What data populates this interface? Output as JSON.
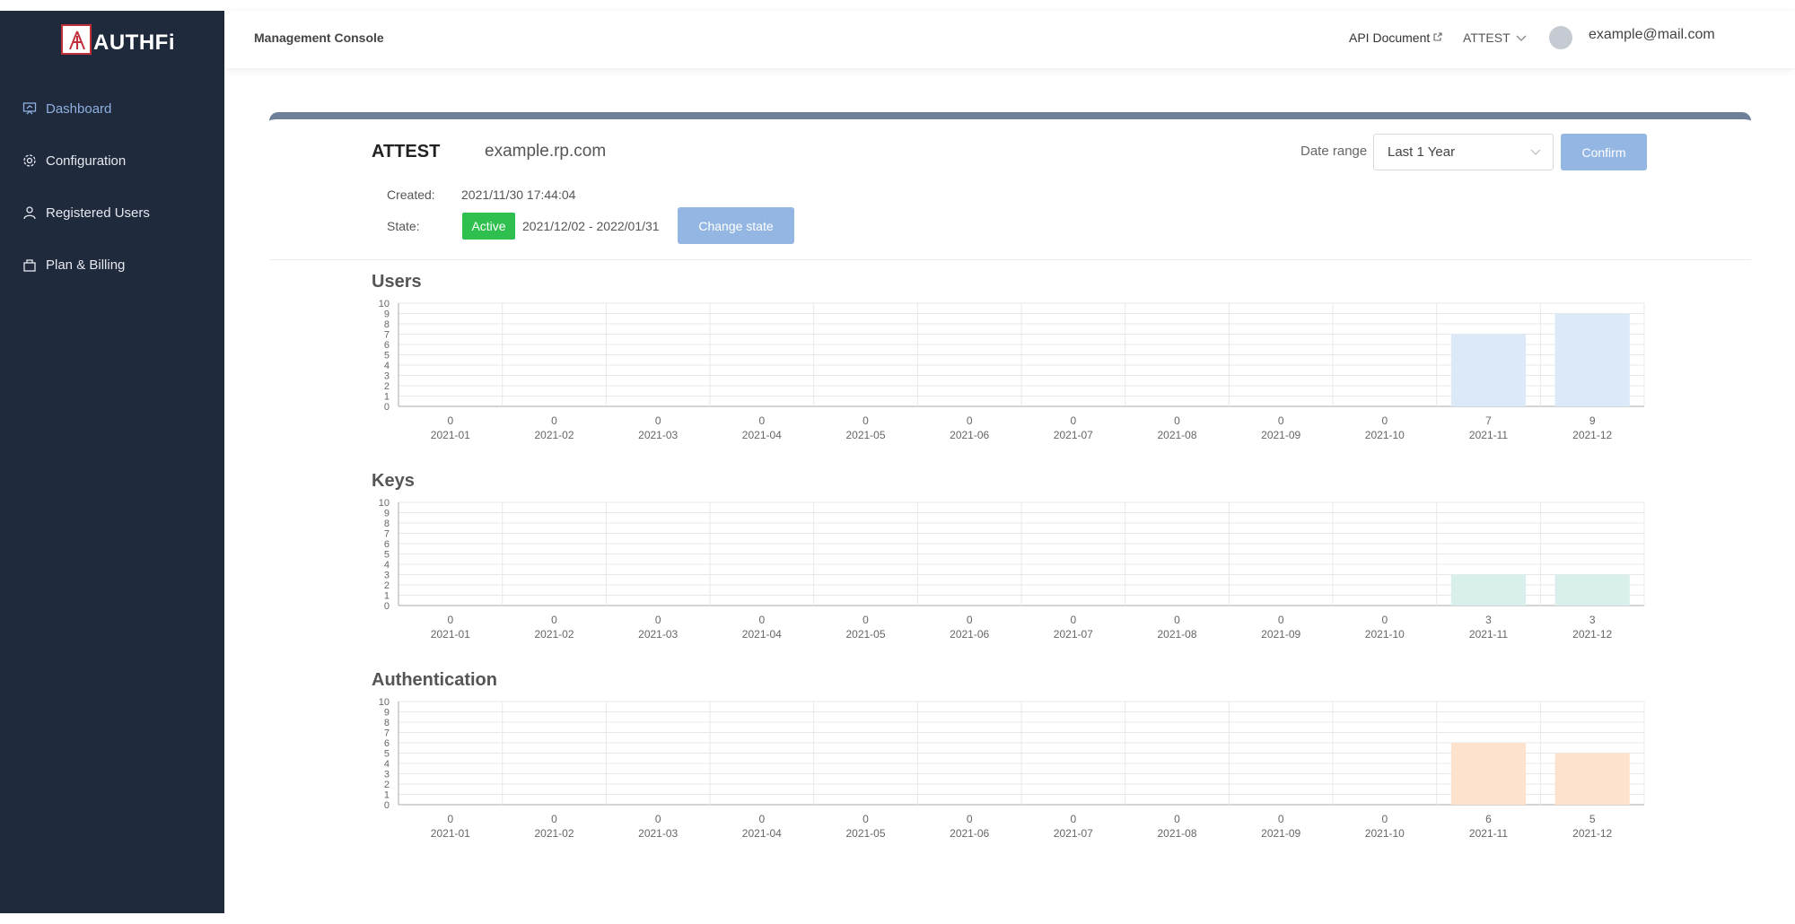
{
  "sidebar": {
    "logo_text": "AUTHFi",
    "items": [
      {
        "label": "Dashboard",
        "icon": "dashboard-icon",
        "active": true
      },
      {
        "label": "Configuration",
        "icon": "gear-icon",
        "active": false
      },
      {
        "label": "Registered Users",
        "icon": "user-icon",
        "active": false
      },
      {
        "label": "Plan & Billing",
        "icon": "bag-icon",
        "active": false
      }
    ]
  },
  "header": {
    "title": "Management Console",
    "api_document": "API Document",
    "tenant": "ATTEST",
    "email": "example@mail.com"
  },
  "app": {
    "name": "ATTEST",
    "domain": "example.rp.com",
    "created_label": "Created:",
    "created_value": "2021/11/30 17:44:04",
    "state_label": "State:",
    "state_badge": "Active",
    "state_period": "2021/12/02 - 2022/01/31",
    "change_state_label": "Change state",
    "date_range_label": "Date range",
    "date_range_value": "Last 1 Year",
    "confirm_label": "Confirm"
  },
  "colors": {
    "sidebar_bg": "#1f2a3d",
    "accent_blue": "#94b6e2",
    "active_green": "#2fbf4f",
    "users_bar": "#dbe9f8",
    "keys_bar": "#d9efeb",
    "auth_bar": "#fde3cd"
  },
  "chart_data": [
    {
      "type": "bar",
      "title": "Users",
      "categories": [
        "2021-01",
        "2021-02",
        "2021-03",
        "2021-04",
        "2021-05",
        "2021-06",
        "2021-07",
        "2021-08",
        "2021-09",
        "2021-10",
        "2021-11",
        "2021-12"
      ],
      "values": [
        0,
        0,
        0,
        0,
        0,
        0,
        0,
        0,
        0,
        0,
        7,
        9
      ],
      "ylim": [
        0,
        10
      ],
      "yticks": [
        0,
        1,
        2,
        3,
        4,
        5,
        6,
        7,
        8,
        9,
        10
      ],
      "grid": true,
      "color": "#dbe9f8"
    },
    {
      "type": "bar",
      "title": "Keys",
      "categories": [
        "2021-01",
        "2021-02",
        "2021-03",
        "2021-04",
        "2021-05",
        "2021-06",
        "2021-07",
        "2021-08",
        "2021-09",
        "2021-10",
        "2021-11",
        "2021-12"
      ],
      "values": [
        0,
        0,
        0,
        0,
        0,
        0,
        0,
        0,
        0,
        0,
        3,
        3
      ],
      "ylim": [
        0,
        10
      ],
      "yticks": [
        0,
        1,
        2,
        3,
        4,
        5,
        6,
        7,
        8,
        9,
        10
      ],
      "grid": true,
      "color": "#d9efeb"
    },
    {
      "type": "bar",
      "title": "Authentication",
      "categories": [
        "2021-01",
        "2021-02",
        "2021-03",
        "2021-04",
        "2021-05",
        "2021-06",
        "2021-07",
        "2021-08",
        "2021-09",
        "2021-10",
        "2021-11",
        "2021-12"
      ],
      "values": [
        0,
        0,
        0,
        0,
        0,
        0,
        0,
        0,
        0,
        0,
        6,
        5
      ],
      "ylim": [
        0,
        10
      ],
      "yticks": [
        0,
        1,
        2,
        3,
        4,
        5,
        6,
        7,
        8,
        9,
        10
      ],
      "grid": true,
      "color": "#fde3cd"
    }
  ]
}
